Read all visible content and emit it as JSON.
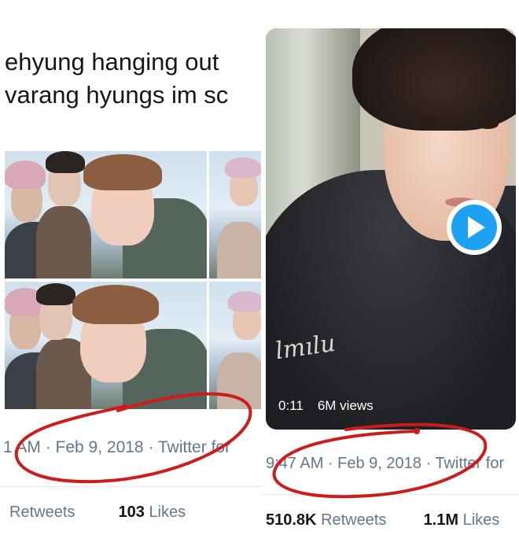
{
  "left_tweet": {
    "text_line1": "ehyung hanging out",
    "text_line2": "varang hyungs im sc",
    "photos": [
      "group-selfie-top",
      "partial-right-top",
      "group-selfie-bottom",
      "partial-right-bottom"
    ],
    "timestamp_prefix": "1 AM",
    "timestamp_rest": " · Feb 9, 2018 · Twitter for",
    "retweets_label": "Retweets",
    "likes_count": "103",
    "likes_label": "Likes"
  },
  "right_tweet": {
    "video_duration": "0:11",
    "video_views": "6M views",
    "play_icon": "play-icon",
    "hoodie_text": "lmılu",
    "timestamp": "9:47 AM · Feb 9, 2018 · Twitter for",
    "retweets_count": "510.8K",
    "retweets_label": "Retweets",
    "likes_count": "1.1M",
    "likes_label": "Likes"
  },
  "colors": {
    "annotation_red": "#cc1d1d",
    "twitter_blue": "#1da1f2",
    "meta_gray": "#657786"
  }
}
